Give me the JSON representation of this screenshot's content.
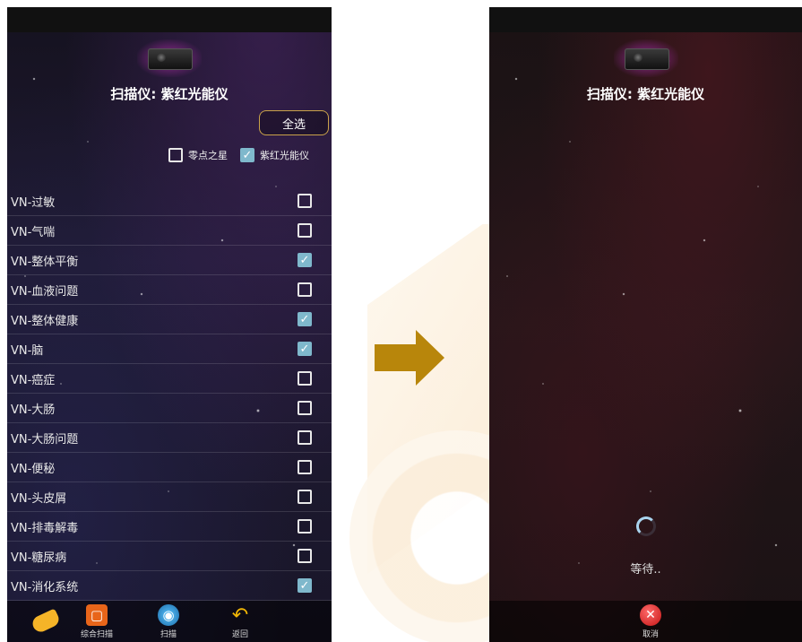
{
  "left_screen": {
    "title": "扫描仪: 紫红光能仪",
    "select_all_label": "全选",
    "filters": [
      {
        "label": "零点之星",
        "checked": false
      },
      {
        "label": "紫红光能仪",
        "checked": true
      }
    ],
    "items": [
      {
        "label": "VN-过敏",
        "checked": false
      },
      {
        "label": "VN-气喘",
        "checked": false
      },
      {
        "label": "VN-整体平衡",
        "checked": true
      },
      {
        "label": "VN-血液问题",
        "checked": false
      },
      {
        "label": "VN-整体健康",
        "checked": true
      },
      {
        "label": "VN-脑",
        "checked": true
      },
      {
        "label": "VN-癌症",
        "checked": false
      },
      {
        "label": "VN-大肠",
        "checked": false
      },
      {
        "label": "VN-大肠问题",
        "checked": false
      },
      {
        "label": "VN-便秘",
        "checked": false
      },
      {
        "label": "VN-头皮屑",
        "checked": false
      },
      {
        "label": "VN-排毒解毒",
        "checked": false
      },
      {
        "label": "VN-糖尿病",
        "checked": false
      },
      {
        "label": "VN-消化系统",
        "checked": true
      }
    ],
    "nav": {
      "scan_all_label": "综合扫描",
      "scan_label": "扫描",
      "back_label": "返回"
    }
  },
  "right_screen": {
    "title": "扫描仪: 紫红光能仪",
    "wait_text": "等待..",
    "cancel_label": "取消"
  },
  "colors": {
    "accent_gold": "#b8860b",
    "checkbox_checked": "#7fb8cc",
    "select_all_border": "#c9a24a"
  }
}
